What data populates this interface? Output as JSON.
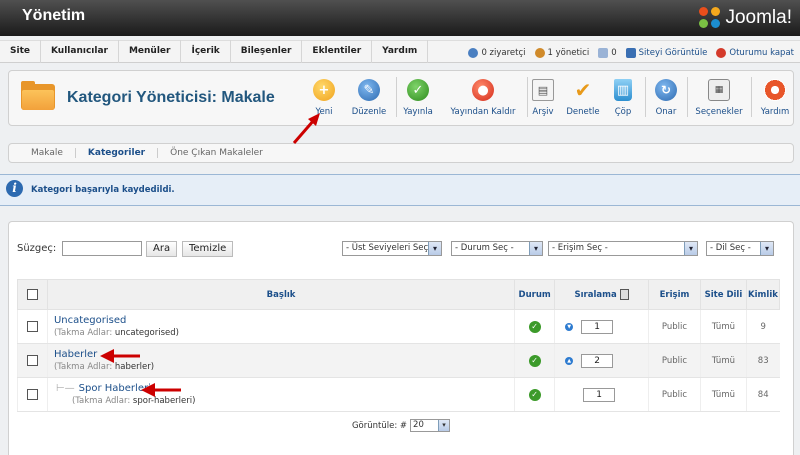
{
  "header": {
    "title": "Yönetim",
    "logo_text": "Joomla!"
  },
  "menu": {
    "items": [
      "Site",
      "Kullanıcılar",
      "Menüler",
      "İçerik",
      "Bileşenler",
      "Eklentiler",
      "Yardım"
    ]
  },
  "status": {
    "visitors": "0 ziyaretçi",
    "admins": "1 yönetici",
    "messages": "0",
    "view_site": "Siteyi Görüntüle",
    "logout": "Oturumu kapat"
  },
  "toolbar": {
    "title": "Kategori Yöneticisi: Makale",
    "new": "Yeni",
    "edit": "Düzenle",
    "publish": "Yayınla",
    "unpublish": "Yayından Kaldır",
    "archive": "Arşiv",
    "checkin": "Denetle",
    "trash": "Çöp",
    "rebuild": "Onar",
    "options": "Seçenekler",
    "help": "Yardım"
  },
  "subnav": {
    "tabs": [
      "Makale",
      "Kategoriler",
      "Öne Çıkan Makaleler"
    ],
    "active": "Kategoriler"
  },
  "message": "Kategori başarıyla kaydedildi.",
  "filter": {
    "label": "Süzgeç:",
    "value": "",
    "search_button": "Ara",
    "clear_button": "Temizle",
    "level": "- Üst Seviyeleri Seç -",
    "state": "- Durum Seç -",
    "access": "- Erişim Seç -",
    "language": "- Dil Seç -"
  },
  "table": {
    "headers": {
      "title": "Başlık",
      "status": "Durum",
      "ordering": "Sıralama",
      "access": "Erişim",
      "language": "Site Dili",
      "id": "Kimlik"
    },
    "alias_label": "(Takma Adlar:",
    "rows": [
      {
        "title": "Uncategorised",
        "alias": "uncategorised)",
        "order": "1",
        "access": "Public",
        "language": "Tümü",
        "id": "9"
      },
      {
        "title": "Haberler",
        "alias": "haberler)",
        "order": "2",
        "access": "Public",
        "language": "Tümü",
        "id": "83"
      },
      {
        "title": "Spor Haberleri",
        "alias": "spor-haberleri)",
        "order": "1",
        "access": "Public",
        "language": "Tümü",
        "id": "84"
      }
    ]
  },
  "pager": {
    "label": "Görüntüle: #",
    "value": "20"
  },
  "colors": {
    "link": "#1c4f8a",
    "annotation_arrow": "#cc0000"
  }
}
